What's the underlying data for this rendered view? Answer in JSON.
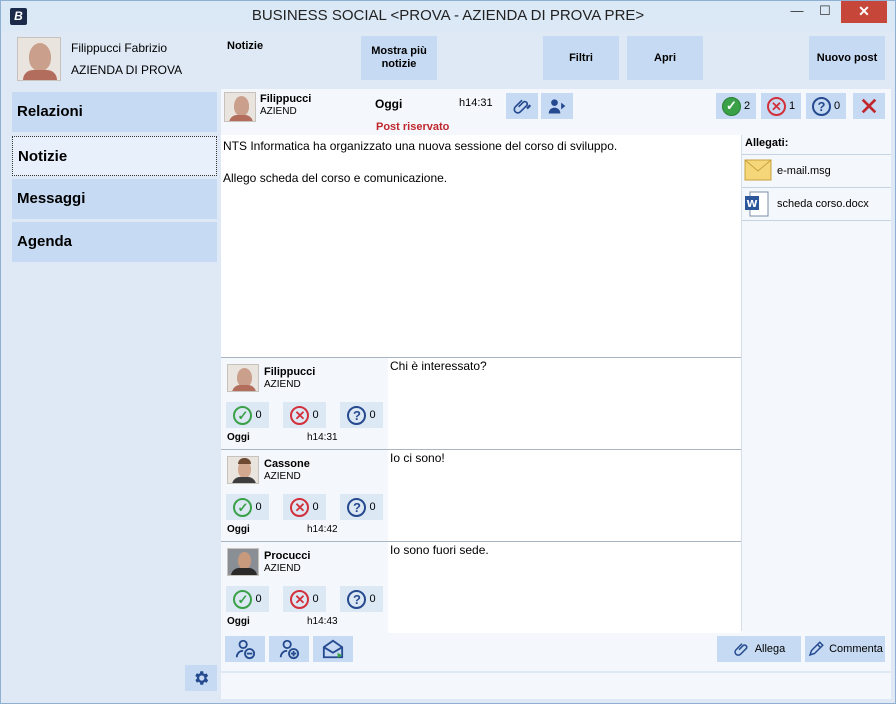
{
  "window": {
    "title": "BUSINESS SOCIAL <PROVA - AZIENDA DI PROVA PRE>",
    "app_icon": "B",
    "minimize": "—",
    "maximize": "☐",
    "close": "✕"
  },
  "user": {
    "name": "Filippucci Fabrizio",
    "company": "AZIENDA DI PROVA"
  },
  "toolbar": {
    "section": "Notizie",
    "more_news_line1": "Mostra più",
    "more_news_line2": "notizie",
    "filters": "Filtri",
    "open": "Apri",
    "new_post": "Nuovo post"
  },
  "sidebar": {
    "items": [
      {
        "label": "Relazioni"
      },
      {
        "label": "Notizie"
      },
      {
        "label": "Messaggi"
      },
      {
        "label": "Agenda"
      }
    ]
  },
  "post": {
    "author": "Filippucci",
    "company": "AZIEND",
    "day": "Oggi",
    "time": "h14:31",
    "reserved": "Post riservato",
    "approve_count": "2",
    "reject_count": "1",
    "question_count": "0",
    "body_line1": "NTS Informatica ha organizzato una nuova sessione del corso di sviluppo.",
    "body_line2": "Allego scheda del corso e comunicazione."
  },
  "attachments": {
    "title": "Allegati:",
    "items": [
      {
        "name": "e-mail.msg",
        "icon": "envelope-icon"
      },
      {
        "name": "scheda corso.docx",
        "icon": "word-doc-icon"
      }
    ]
  },
  "comments": [
    {
      "author": "Filippucci",
      "company": "AZIEND",
      "text": "Chi è interessato?",
      "ok": "0",
      "no": "0",
      "q": "0",
      "day": "Oggi",
      "time": "h14:31"
    },
    {
      "author": "Cassone",
      "company": "AZIEND",
      "text": "Io ci sono!",
      "ok": "0",
      "no": "0",
      "q": "0",
      "day": "Oggi",
      "time": "h14:42"
    },
    {
      "author": "Procucci",
      "company": "AZIEND",
      "text": "Io sono fuori sede.",
      "ok": "0",
      "no": "0",
      "q": "0",
      "day": "Oggi",
      "time": "h14:43"
    }
  ],
  "footer": {
    "attach": "Allega",
    "comment": "Commenta"
  },
  "colors": {
    "button_bg": "#c6dbf3",
    "window_bg": "#dfe9f5",
    "close_red": "#c7463a",
    "reserved_red": "#c0272d",
    "approve_green": "#3aa148",
    "reject_red": "#d2303a",
    "question_blue": "#264a8f"
  }
}
